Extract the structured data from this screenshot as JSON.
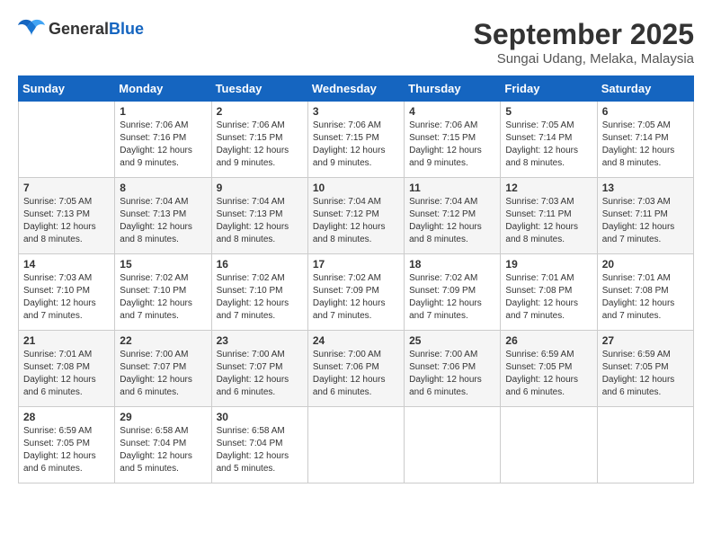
{
  "header": {
    "logo_general": "General",
    "logo_blue": "Blue",
    "month": "September 2025",
    "location": "Sungai Udang, Melaka, Malaysia"
  },
  "days_of_week": [
    "Sunday",
    "Monday",
    "Tuesday",
    "Wednesday",
    "Thursday",
    "Friday",
    "Saturday"
  ],
  "weeks": [
    [
      {
        "day": "",
        "sunrise": "",
        "sunset": "",
        "daylight": ""
      },
      {
        "day": "1",
        "sunrise": "Sunrise: 7:06 AM",
        "sunset": "Sunset: 7:16 PM",
        "daylight": "Daylight: 12 hours and 9 minutes."
      },
      {
        "day": "2",
        "sunrise": "Sunrise: 7:06 AM",
        "sunset": "Sunset: 7:15 PM",
        "daylight": "Daylight: 12 hours and 9 minutes."
      },
      {
        "day": "3",
        "sunrise": "Sunrise: 7:06 AM",
        "sunset": "Sunset: 7:15 PM",
        "daylight": "Daylight: 12 hours and 9 minutes."
      },
      {
        "day": "4",
        "sunrise": "Sunrise: 7:06 AM",
        "sunset": "Sunset: 7:15 PM",
        "daylight": "Daylight: 12 hours and 9 minutes."
      },
      {
        "day": "5",
        "sunrise": "Sunrise: 7:05 AM",
        "sunset": "Sunset: 7:14 PM",
        "daylight": "Daylight: 12 hours and 8 minutes."
      },
      {
        "day": "6",
        "sunrise": "Sunrise: 7:05 AM",
        "sunset": "Sunset: 7:14 PM",
        "daylight": "Daylight: 12 hours and 8 minutes."
      }
    ],
    [
      {
        "day": "7",
        "sunrise": "Sunrise: 7:05 AM",
        "sunset": "Sunset: 7:13 PM",
        "daylight": "Daylight: 12 hours and 8 minutes."
      },
      {
        "day": "8",
        "sunrise": "Sunrise: 7:04 AM",
        "sunset": "Sunset: 7:13 PM",
        "daylight": "Daylight: 12 hours and 8 minutes."
      },
      {
        "day": "9",
        "sunrise": "Sunrise: 7:04 AM",
        "sunset": "Sunset: 7:13 PM",
        "daylight": "Daylight: 12 hours and 8 minutes."
      },
      {
        "day": "10",
        "sunrise": "Sunrise: 7:04 AM",
        "sunset": "Sunset: 7:12 PM",
        "daylight": "Daylight: 12 hours and 8 minutes."
      },
      {
        "day": "11",
        "sunrise": "Sunrise: 7:04 AM",
        "sunset": "Sunset: 7:12 PM",
        "daylight": "Daylight: 12 hours and 8 minutes."
      },
      {
        "day": "12",
        "sunrise": "Sunrise: 7:03 AM",
        "sunset": "Sunset: 7:11 PM",
        "daylight": "Daylight: 12 hours and 8 minutes."
      },
      {
        "day": "13",
        "sunrise": "Sunrise: 7:03 AM",
        "sunset": "Sunset: 7:11 PM",
        "daylight": "Daylight: 12 hours and 7 minutes."
      }
    ],
    [
      {
        "day": "14",
        "sunrise": "Sunrise: 7:03 AM",
        "sunset": "Sunset: 7:10 PM",
        "daylight": "Daylight: 12 hours and 7 minutes."
      },
      {
        "day": "15",
        "sunrise": "Sunrise: 7:02 AM",
        "sunset": "Sunset: 7:10 PM",
        "daylight": "Daylight: 12 hours and 7 minutes."
      },
      {
        "day": "16",
        "sunrise": "Sunrise: 7:02 AM",
        "sunset": "Sunset: 7:10 PM",
        "daylight": "Daylight: 12 hours and 7 minutes."
      },
      {
        "day": "17",
        "sunrise": "Sunrise: 7:02 AM",
        "sunset": "Sunset: 7:09 PM",
        "daylight": "Daylight: 12 hours and 7 minutes."
      },
      {
        "day": "18",
        "sunrise": "Sunrise: 7:02 AM",
        "sunset": "Sunset: 7:09 PM",
        "daylight": "Daylight: 12 hours and 7 minutes."
      },
      {
        "day": "19",
        "sunrise": "Sunrise: 7:01 AM",
        "sunset": "Sunset: 7:08 PM",
        "daylight": "Daylight: 12 hours and 7 minutes."
      },
      {
        "day": "20",
        "sunrise": "Sunrise: 7:01 AM",
        "sunset": "Sunset: 7:08 PM",
        "daylight": "Daylight: 12 hours and 7 minutes."
      }
    ],
    [
      {
        "day": "21",
        "sunrise": "Sunrise: 7:01 AM",
        "sunset": "Sunset: 7:08 PM",
        "daylight": "Daylight: 12 hours and 6 minutes."
      },
      {
        "day": "22",
        "sunrise": "Sunrise: 7:00 AM",
        "sunset": "Sunset: 7:07 PM",
        "daylight": "Daylight: 12 hours and 6 minutes."
      },
      {
        "day": "23",
        "sunrise": "Sunrise: 7:00 AM",
        "sunset": "Sunset: 7:07 PM",
        "daylight": "Daylight: 12 hours and 6 minutes."
      },
      {
        "day": "24",
        "sunrise": "Sunrise: 7:00 AM",
        "sunset": "Sunset: 7:06 PM",
        "daylight": "Daylight: 12 hours and 6 minutes."
      },
      {
        "day": "25",
        "sunrise": "Sunrise: 7:00 AM",
        "sunset": "Sunset: 7:06 PM",
        "daylight": "Daylight: 12 hours and 6 minutes."
      },
      {
        "day": "26",
        "sunrise": "Sunrise: 6:59 AM",
        "sunset": "Sunset: 7:05 PM",
        "daylight": "Daylight: 12 hours and 6 minutes."
      },
      {
        "day": "27",
        "sunrise": "Sunrise: 6:59 AM",
        "sunset": "Sunset: 7:05 PM",
        "daylight": "Daylight: 12 hours and 6 minutes."
      }
    ],
    [
      {
        "day": "28",
        "sunrise": "Sunrise: 6:59 AM",
        "sunset": "Sunset: 7:05 PM",
        "daylight": "Daylight: 12 hours and 6 minutes."
      },
      {
        "day": "29",
        "sunrise": "Sunrise: 6:58 AM",
        "sunset": "Sunset: 7:04 PM",
        "daylight": "Daylight: 12 hours and 5 minutes."
      },
      {
        "day": "30",
        "sunrise": "Sunrise: 6:58 AM",
        "sunset": "Sunset: 7:04 PM",
        "daylight": "Daylight: 12 hours and 5 minutes."
      },
      {
        "day": "",
        "sunrise": "",
        "sunset": "",
        "daylight": ""
      },
      {
        "day": "",
        "sunrise": "",
        "sunset": "",
        "daylight": ""
      },
      {
        "day": "",
        "sunrise": "",
        "sunset": "",
        "daylight": ""
      },
      {
        "day": "",
        "sunrise": "",
        "sunset": "",
        "daylight": ""
      }
    ]
  ]
}
